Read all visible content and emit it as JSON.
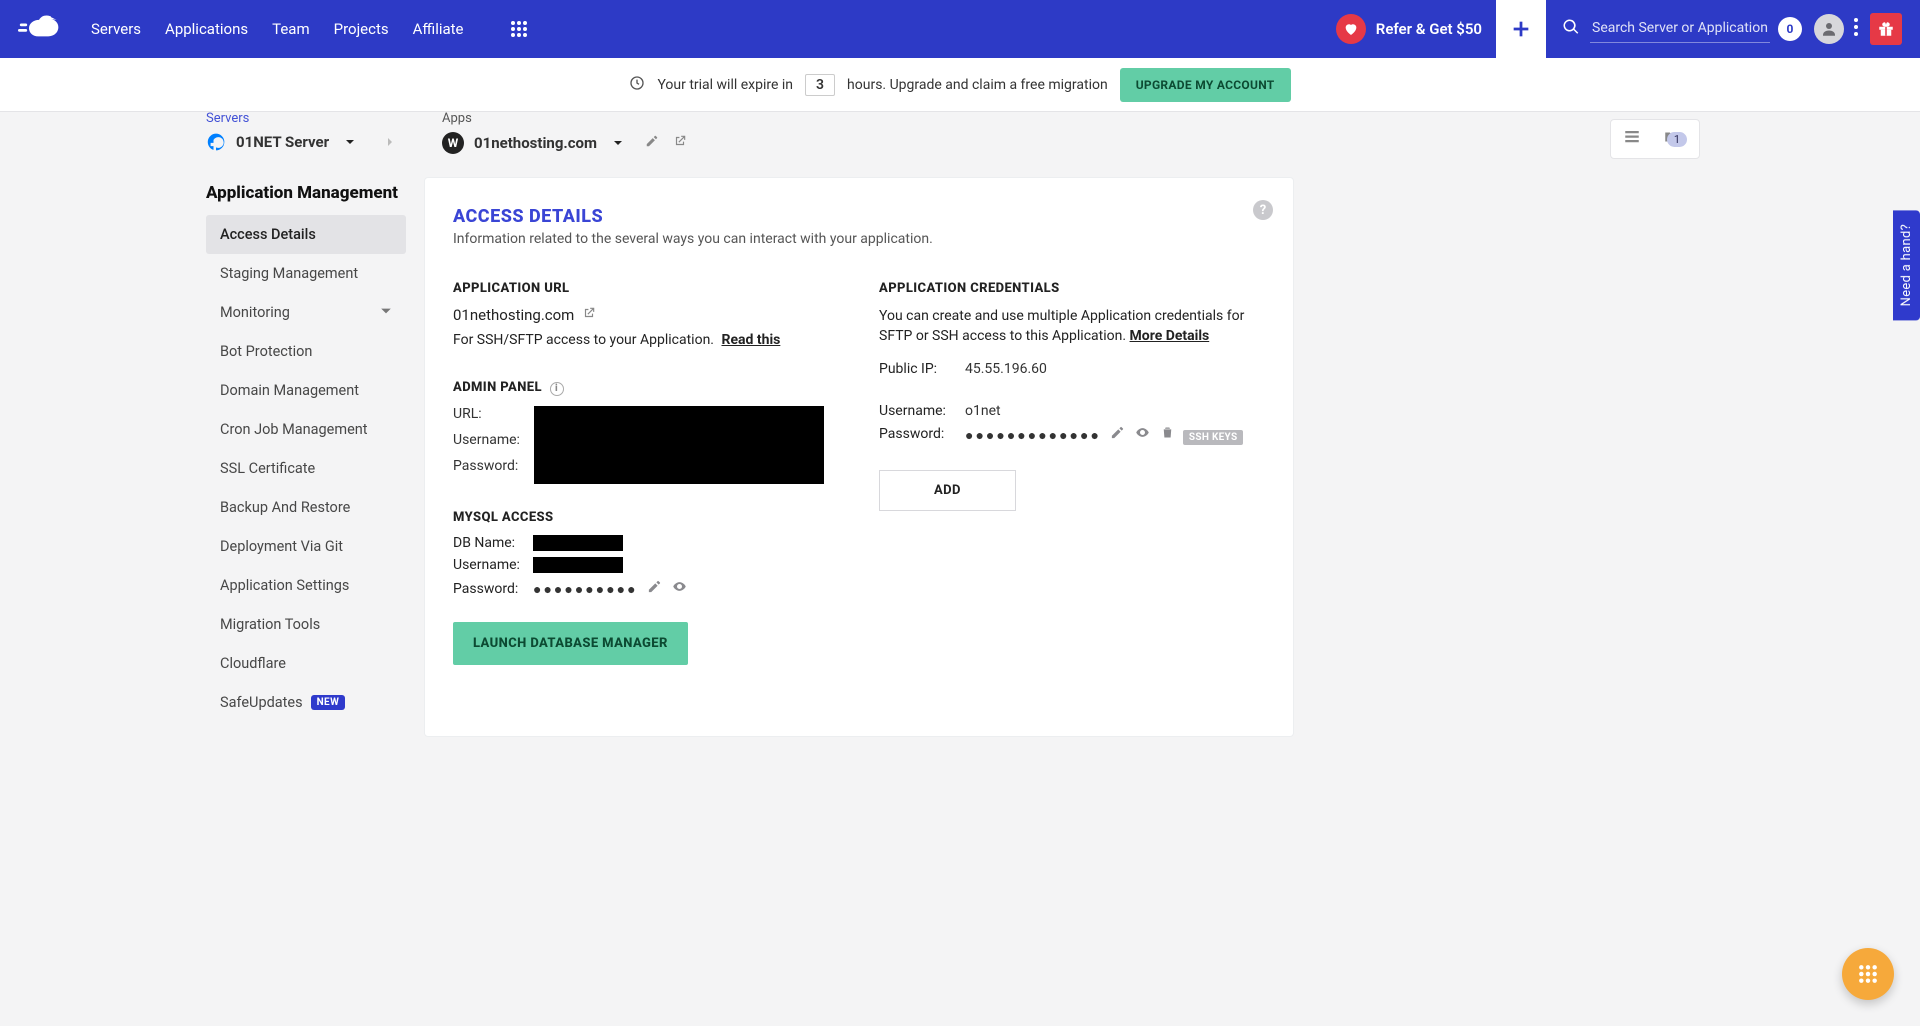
{
  "topnav": {
    "items": [
      "Servers",
      "Applications",
      "Team",
      "Projects",
      "Affiliate"
    ],
    "refer_label": "Refer & Get $50",
    "search_placeholder": "Search Server or Application",
    "notif_count": "0"
  },
  "trialbar": {
    "prefix": "Your trial will expire in",
    "hours": "3",
    "suffix": "hours. Upgrade and claim a free migration",
    "upgrade_label": "UPGRADE MY ACCOUNT"
  },
  "breadcrumb": {
    "servers_label": "Servers",
    "server_name": "01NET Server",
    "apps_label": "Apps",
    "app_name": "01nethosting.com",
    "folder_count": "1"
  },
  "sidebar": {
    "title": "Application Management",
    "items": [
      {
        "label": "Access Details",
        "active": true
      },
      {
        "label": "Staging Management"
      },
      {
        "label": "Monitoring",
        "expandable": true
      },
      {
        "label": "Bot Protection"
      },
      {
        "label": "Domain Management"
      },
      {
        "label": "Cron Job Management"
      },
      {
        "label": "SSL Certificate"
      },
      {
        "label": "Backup And Restore"
      },
      {
        "label": "Deployment Via Git"
      },
      {
        "label": "Application Settings"
      },
      {
        "label": "Migration Tools"
      },
      {
        "label": "Cloudflare"
      },
      {
        "label": "SafeUpdates",
        "badge": "NEW"
      }
    ]
  },
  "panel": {
    "title": "ACCESS DETAILS",
    "subtitle": "Information related to the several ways you can interact with your application.",
    "app_url_title": "APPLICATION URL",
    "app_url_value": "01nethosting.com",
    "ssh_note": "For SSH/SFTP access to your Application.",
    "read_this": "Read this",
    "admin_panel_title": "ADMIN PANEL",
    "admin": {
      "url_label": "URL:",
      "user_label": "Username:",
      "pass_label": "Password:"
    },
    "mysql_title": "MYSQL ACCESS",
    "mysql": {
      "dbname_label": "DB Name:",
      "user_label": "Username:",
      "pass_label": "Password:",
      "pass_mask": "●●●●●●●●●●"
    },
    "launch_label": "LAUNCH DATABASE MANAGER",
    "cred_title": "APPLICATION CREDENTIALS",
    "cred_note": "You can create and use multiple Application credentials for SFTP or SSH access to this Application. ",
    "more_details": "More Details",
    "public_ip_label": "Public IP:",
    "public_ip": "45.55.196.60",
    "cred_user_label": "Username:",
    "cred_user": "o1net",
    "cred_pass_label": "Password:",
    "cred_pass_mask": "●●●●●●●●●●●●●",
    "ssh_keys_label": "SSH KEYS",
    "add_label": "ADD"
  },
  "floats": {
    "need_hand": "Need a hand?"
  }
}
